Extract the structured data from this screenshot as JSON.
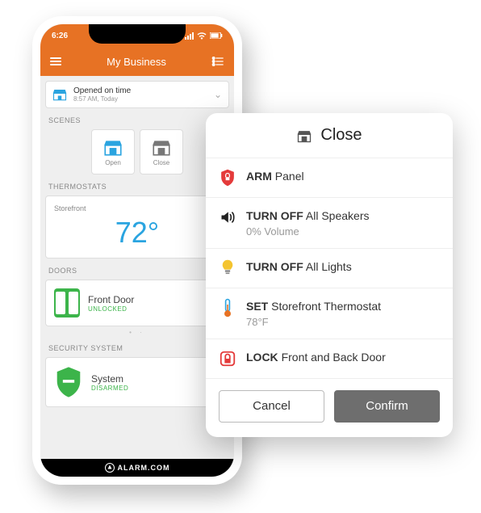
{
  "statusbar": {
    "time": "6:26"
  },
  "appbar": {
    "title": "My Business"
  },
  "alert": {
    "title": "Opened on time",
    "subtitle": "8:57 AM, Today"
  },
  "sections": {
    "scenes": "SCENES",
    "thermostats": "THERMOSTATS",
    "doors": "DOORS",
    "security": "SECURITY SYSTEM"
  },
  "scenes": {
    "open": "Open",
    "close": "Close"
  },
  "thermostat": {
    "location": "Storefront",
    "temp": "72°"
  },
  "door": {
    "name": "Front Door",
    "status": "UNLOCKED"
  },
  "security": {
    "name": "System",
    "status": "DISARMED"
  },
  "brand": "ALARM.COM",
  "modal": {
    "title": "Close",
    "actions": {
      "arm": {
        "verb": "ARM",
        "target": "Panel"
      },
      "speakers": {
        "verb": "TURN OFF",
        "target": "All Speakers",
        "sub": "0% Volume"
      },
      "lights": {
        "verb": "TURN OFF",
        "target": "All Lights"
      },
      "thermo": {
        "verb": "SET",
        "target": "Storefront Thermostat",
        "sub": "78°F"
      },
      "lock": {
        "verb": "LOCK",
        "target": "Front and Back Door"
      }
    },
    "cancel": "Cancel",
    "confirm": "Confirm"
  }
}
